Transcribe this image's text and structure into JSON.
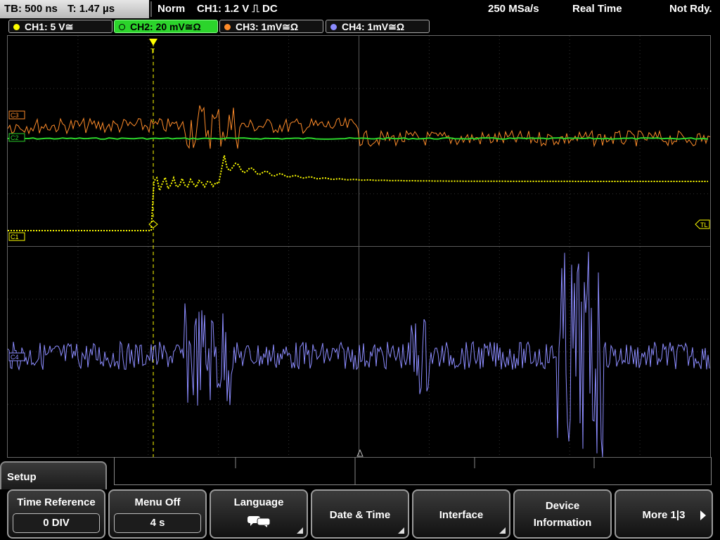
{
  "header": {
    "timebase": "TB: 500 ns",
    "trigger_time": "T: 1.47 µs",
    "mode": "Norm",
    "trigger_info": "CH1: 1.2 V ⎍ DC",
    "sample_rate": "250 MSa/s",
    "acq_mode": "Real Time",
    "status": "Not Rdy."
  },
  "channels": [
    {
      "label": "CH1: 5 V≅",
      "color": "#ffff00"
    },
    {
      "label": "CH2: 20 mV≅Ω",
      "color": "#2bd42b"
    },
    {
      "label": "CH3: 1mV≅Ω",
      "color": "#ff8c2a"
    },
    {
      "label": "CH4: 1mV≅Ω",
      "color": "#8c8cff"
    }
  ],
  "markers": {
    "c3": "C3",
    "c2": "C2",
    "c1": "C1",
    "c4": "C4",
    "tl": "TL",
    "trigger": "T"
  },
  "menu": {
    "title": "Setup",
    "softkeys": [
      {
        "label": "Time Reference",
        "value": "0 DIV"
      },
      {
        "label": "Menu Off",
        "value": "4 s"
      },
      {
        "label": "Language"
      },
      {
        "label": "Date & Time"
      },
      {
        "label": "Interface"
      },
      {
        "label": "Device Information",
        "line1": "Device",
        "line2": "Information"
      },
      {
        "label": "More 1|3"
      }
    ]
  },
  "colors": {
    "ch1": "#ffff00",
    "ch2": "#2bd42b",
    "ch3": "#ff8c2a",
    "ch4": "#8c8cff",
    "grid": "#3c3c3c"
  }
}
